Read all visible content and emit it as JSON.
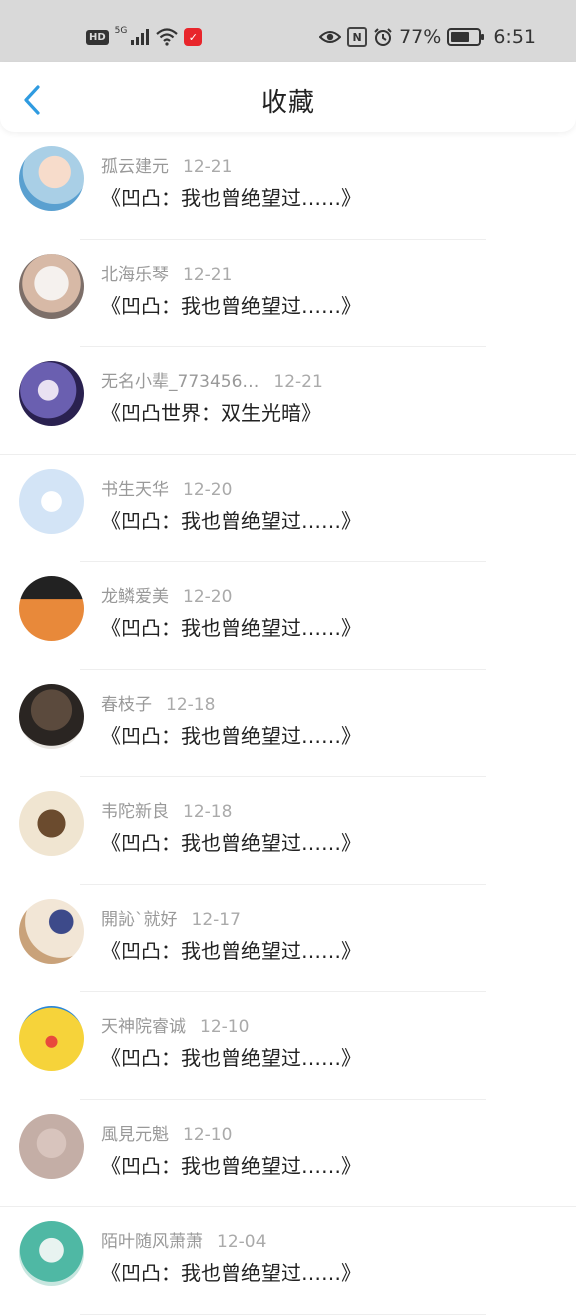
{
  "status_bar": {
    "left_badge": "HD",
    "signal_label": "5G",
    "app_badge": "✓",
    "battery": "77%",
    "time": "6:51",
    "battery_level": 0.77
  },
  "header": {
    "title": "收藏"
  },
  "items": [
    {
      "name": "孤云建元",
      "date": "12-21",
      "work": "《凹凸：我也曾绝望过……》"
    },
    {
      "name": "北海乐琴",
      "date": "12-21",
      "work": "《凹凸：我也曾绝望过……》"
    },
    {
      "name": "无名小辈_773456…",
      "date": "12-21",
      "work": "《凹凸世界：双生光暗》"
    },
    {
      "name": "书生天华",
      "date": "12-20",
      "work": "《凹凸：我也曾绝望过……》"
    },
    {
      "name": "龙鳞爱美",
      "date": "12-20",
      "work": "《凹凸：我也曾绝望过……》"
    },
    {
      "name": "春枝子",
      "date": "12-18",
      "work": "《凹凸：我也曾绝望过……》"
    },
    {
      "name": "韦陀新良",
      "date": "12-18",
      "work": "《凹凸：我也曾绝望过……》"
    },
    {
      "name": "開訫`就好",
      "date": "12-17",
      "work": "《凹凸：我也曾绝望过……》"
    },
    {
      "name": "天神院睿诚",
      "date": "12-10",
      "work": "《凹凸：我也曾绝望过……》"
    },
    {
      "name": "風見元魁",
      "date": "12-10",
      "work": "《凹凸：我也曾绝望过……》"
    },
    {
      "name": "陌叶随风萧萧",
      "date": "12-04",
      "work": "《凹凸：我也曾绝望过……》"
    }
  ],
  "colors": {
    "accent": "#2f9be0",
    "status_bg": "#d9d9d9",
    "name_text": "#999999",
    "title_text": "#222222"
  }
}
